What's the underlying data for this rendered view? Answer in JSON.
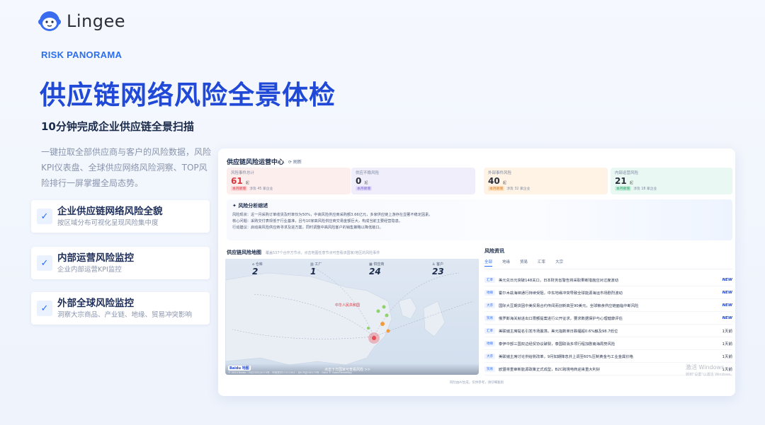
{
  "brand": {
    "name": "Lingee"
  },
  "hero": {
    "eyebrow": "RISK PANORAMA",
    "title": "供应链网络风险全景体检",
    "subtitle": "10分钟完成企业供应链全景扫描",
    "description": "一键拉取全部供应商与客户的风险数据，风险KPI仪表盘、全球供应网络风险洞察、TOP风险排行一屏掌握全局态势。"
  },
  "features": [
    {
      "title": "企业供应链网络风险全貌",
      "subtitle": "按区域分布可视化呈现风险集中度"
    },
    {
      "title": "内部运营风险监控",
      "subtitle": "企业内部运营KPI监控"
    },
    {
      "title": "外部全球风险监控",
      "subtitle": "洞察大宗商品、产业链、地缘、贸易冲突影响"
    }
  ],
  "dashboard": {
    "title": "供应链风险运营中心",
    "refresh_label": "刷新",
    "kpis": [
      {
        "label": "风险事件总计",
        "value": "61",
        "unit": "起",
        "tag": "本月新增",
        "meta": "涉及 45 家企业"
      },
      {
        "label": "供应不稳风险",
        "value": "0",
        "unit": "起",
        "tag": "本月新增",
        "meta": ""
      },
      {
        "label": "外部事件风险",
        "value": "40",
        "unit": "起",
        "tag": "本月新增",
        "meta": "涉及 32 家企业"
      },
      {
        "label": "内部运营风险",
        "value": "21",
        "unit": "起",
        "tag": "本月新增",
        "meta": "涉及 18 家企业"
      }
    ],
    "analysis": {
      "title": "风险分析综述",
      "lines": [
        "风险现状：近一月采购订单收货及时率仅为50%，中高风险供应商采购额3.66亿元，多家供应链上游存在显著不稳定因素。",
        "核心问题：采购交付表现低于行业基准，且与10家高风险供应商交易金额巨大，构成当前主要经营隐患。",
        "行动建议：启动高风险供应商寻求及进方案，同时调整中高风险客户的销售策略以降低敞口。"
      ]
    },
    "map": {
      "title": "供应链风险地图",
      "subtitle": "覆盖537个合作方节点，点击地图任意节点可查看该国家/地区的风险事件",
      "stats": [
        {
          "label": "仓库",
          "value": "2"
        },
        {
          "label": "工厂",
          "value": "1"
        },
        {
          "label": "供应商",
          "value": "24"
        },
        {
          "label": "客户",
          "value": "23"
        }
      ],
      "country_label": "中华人民共和国",
      "bottom_note": "点击下方国家可查看风险 >>",
      "copyright": "© 2024 Baidu - GS(2023)4174号 - 甲测资字11111342 - 京ICP证030173号 - Data © OpenStreetMap",
      "provider": "Baidu 地图"
    },
    "news": {
      "title": "风险资讯",
      "tabs": [
        "全部",
        "地缘",
        "贸易",
        "汇率",
        "大宗"
      ],
      "active_tab": "全部",
      "items": [
        {
          "tag": "汇率",
          "text": "美元兑日元突破148关口，日本财务省警告将采取果断措施应对过度波动",
          "meta": "NEW",
          "new": true
        },
        {
          "tag": "地缘",
          "text": "霍尔木兹海峡通行持续受阻，中东地缘冲突导致全球能源海运市场剧烈波动",
          "meta": "NEW",
          "new": true
        },
        {
          "tag": "大宗",
          "text": "国际大豆期货因中美贸易合约传闻而创新高至90美元，全球粮食供应链面临中断风险",
          "meta": "NEW",
          "new": true
        },
        {
          "tag": "贸易",
          "text": "俄罗斯海关就进出口限额提案进行公开征求，要求数据保护与心理健康评估",
          "meta": "NEW",
          "new": true
        },
        {
          "tag": "汇率",
          "text": "美联储主席提名引发市场震荡，美元指数单日跌幅超0.6%触及98.7低位",
          "meta": "1天前",
          "new": false
        },
        {
          "tag": "地缘",
          "text": "泰伊中部三国双边经贸协议破裂，泰国取消多项行程加剧南海局势风险",
          "meta": "1天前",
          "new": false
        },
        {
          "tag": "大宗",
          "text": "美联储主席讨论供给侧改革，9月如期降息并上调至60%压制黄金与工业金属价格",
          "meta": "1天前",
          "new": false
        },
        {
          "tag": "贸易",
          "text": "欧盟将重审新能源政策正式成型，B2C跨境电商迎来重大利好",
          "meta": "1天前",
          "new": false
        }
      ]
    },
    "disclaimer": "风险由AI生成，仅供参考，请仔细甄别"
  },
  "watermark": {
    "line1": "激活 Windows",
    "line2": "转到\"设置\"以激活 Windows。"
  },
  "colors": {
    "accent": "#1f49d6",
    "brand_blue": "#2b6ef2",
    "risk_red": "#d9363e"
  }
}
